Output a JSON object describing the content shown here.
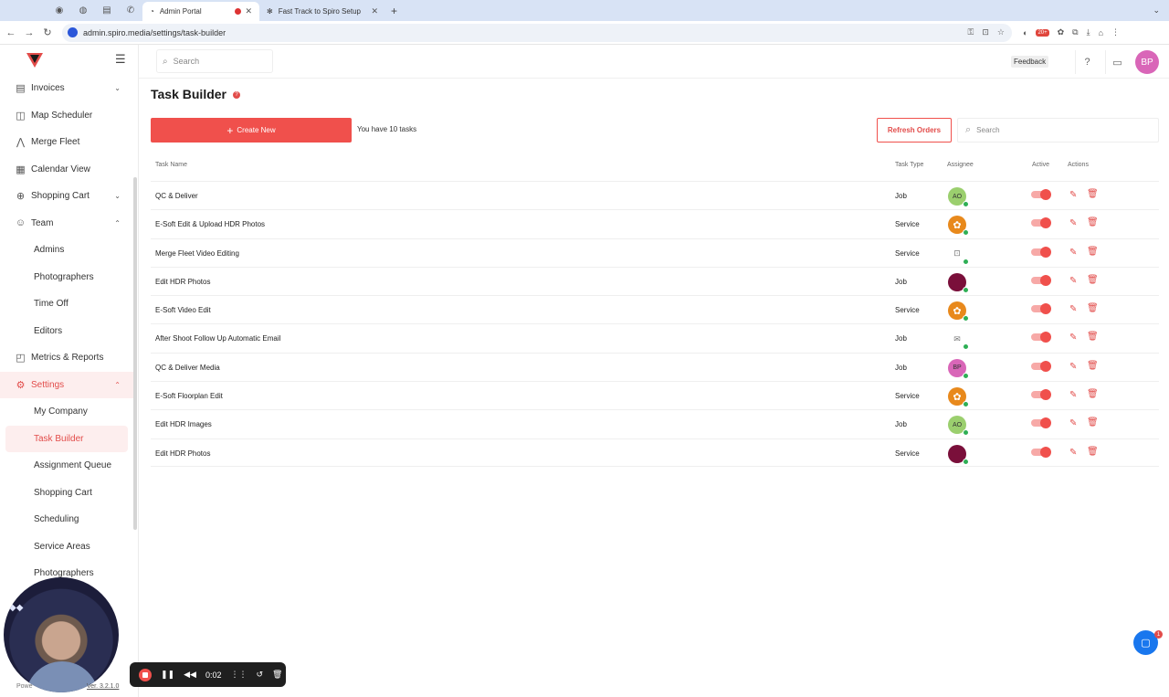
{
  "browser": {
    "tabs": [
      {
        "title": "Admin Portal",
        "active": true
      },
      {
        "title": "Fast Track to Spiro Setup",
        "active": false
      }
    ],
    "url": "admin.spiro.media/settings/task-builder"
  },
  "sidebar": {
    "items": [
      {
        "label": "Invoices",
        "icon": "invoice-icon",
        "caret": "down"
      },
      {
        "label": "Map Scheduler",
        "icon": "map-icon"
      },
      {
        "label": "Merge Fleet",
        "icon": "merge-icon"
      },
      {
        "label": "Calendar View",
        "icon": "calendar-icon"
      },
      {
        "label": "Shopping Cart",
        "icon": "cart-icon",
        "caret": "down"
      },
      {
        "label": "Team",
        "icon": "team-icon",
        "caret": "up"
      },
      {
        "label": "Admins",
        "sub": true
      },
      {
        "label": "Photographers",
        "sub": true
      },
      {
        "label": "Time Off",
        "sub": true
      },
      {
        "label": "Editors",
        "sub": true
      },
      {
        "label": "Metrics & Reports",
        "icon": "chart-icon"
      },
      {
        "label": "Settings",
        "icon": "gear-icon",
        "caret": "up",
        "active": true
      },
      {
        "label": "My Company",
        "sub": true
      },
      {
        "label": "Task Builder",
        "sub": true,
        "active": true
      },
      {
        "label": "Assignment Queue",
        "sub": true
      },
      {
        "label": "Shopping Cart",
        "sub": true
      },
      {
        "label": "Scheduling",
        "sub": true
      },
      {
        "label": "Service Areas",
        "sub": true
      },
      {
        "label": "Photographers",
        "sub": true
      }
    ],
    "powered": "Powe",
    "version": "Ver. 3.2.1.0"
  },
  "topbar": {
    "search_placeholder": "Search",
    "feedback_label": "Feedback",
    "user_initials": "BP"
  },
  "page": {
    "title": "Task Builder",
    "create_label": "Create New",
    "task_count": "You have 10 tasks",
    "refresh_label": "Refresh Orders",
    "search_placeholder": "Search"
  },
  "table": {
    "headers": {
      "name": "Task Name",
      "type": "Task Type",
      "assignee": "Assignee",
      "active": "Active",
      "actions": "Actions"
    },
    "rows": [
      {
        "name": "QC & Deliver",
        "type": "Job",
        "assignee": {
          "kind": "initials",
          "text": "AO",
          "color": "#9bcf6e"
        },
        "active": true
      },
      {
        "name": "E-Soft Edit & Upload HDR Photos",
        "type": "Service",
        "assignee": {
          "kind": "logo",
          "text": "",
          "color": "#e8891c"
        },
        "active": true
      },
      {
        "name": "Merge Fleet Video Editing",
        "type": "Service",
        "assignee": {
          "kind": "video",
          "text": "",
          "color": "#ffffff"
        },
        "active": true
      },
      {
        "name": "Edit HDR Photos",
        "type": "Job",
        "assignee": {
          "kind": "plain",
          "text": "",
          "color": "#7a0f3a"
        },
        "active": true
      },
      {
        "name": "E-Soft Video Edit",
        "type": "Service",
        "assignee": {
          "kind": "logo",
          "text": "",
          "color": "#e8891c"
        },
        "active": true
      },
      {
        "name": "After Shoot Follow Up Automatic Email",
        "type": "Job",
        "assignee": {
          "kind": "mail",
          "text": "",
          "color": "#ffffff"
        },
        "active": true
      },
      {
        "name": "QC & Deliver Media",
        "type": "Job",
        "assignee": {
          "kind": "initials",
          "text": "BP",
          "color": "#d966b8"
        },
        "active": true
      },
      {
        "name": "E-Soft Floorplan Edit",
        "type": "Service",
        "assignee": {
          "kind": "logo",
          "text": "",
          "color": "#e8891c"
        },
        "active": true
      },
      {
        "name": "Edit HDR Images",
        "type": "Job",
        "assignee": {
          "kind": "initials",
          "text": "AO",
          "color": "#9bcf6e"
        },
        "active": true
      },
      {
        "name": "Edit HDR Photos",
        "type": "Service",
        "assignee": {
          "kind": "plain",
          "text": "",
          "color": "#7a0f3a"
        },
        "active": true
      }
    ]
  },
  "recorder": {
    "time": "0:02"
  },
  "chat": {
    "badge": "1"
  },
  "colors": {
    "accent": "#f0504c",
    "online": "#2eaf55"
  }
}
